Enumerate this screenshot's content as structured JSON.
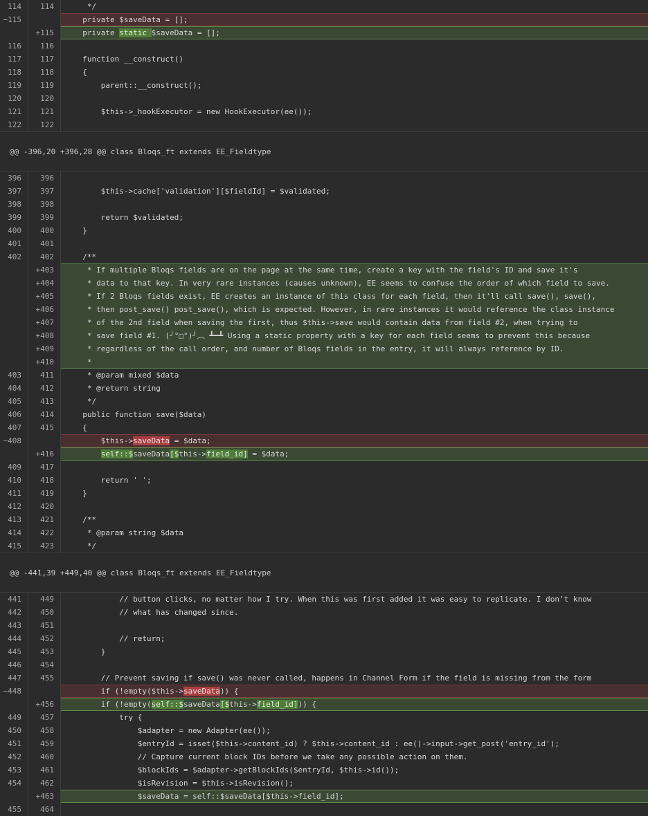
{
  "diff": {
    "blocks": [
      {
        "type": "line",
        "kind": "ctx",
        "old": "114",
        "new": "114",
        "segs": [
          {
            "t": "   */"
          }
        ]
      },
      {
        "type": "line",
        "kind": "del",
        "old": "−115",
        "new": "",
        "segs": [
          {
            "t": "  private $saveData = [];"
          }
        ]
      },
      {
        "type": "line",
        "kind": "add",
        "old": "",
        "new": "+115",
        "segs": [
          {
            "t": "  private "
          },
          {
            "t": "static ",
            "hl": true
          },
          {
            "t": "$saveData = [];"
          }
        ]
      },
      {
        "type": "line",
        "kind": "ctx",
        "old": "116",
        "new": "116",
        "segs": [
          {
            "t": ""
          }
        ]
      },
      {
        "type": "line",
        "kind": "ctx",
        "old": "117",
        "new": "117",
        "segs": [
          {
            "t": "  function __construct()"
          }
        ]
      },
      {
        "type": "line",
        "kind": "ctx",
        "old": "118",
        "new": "118",
        "segs": [
          {
            "t": "  {"
          }
        ]
      },
      {
        "type": "line",
        "kind": "ctx",
        "old": "119",
        "new": "119",
        "segs": [
          {
            "t": "      parent::__construct();"
          }
        ]
      },
      {
        "type": "line",
        "kind": "ctx",
        "old": "120",
        "new": "120",
        "segs": [
          {
            "t": ""
          }
        ]
      },
      {
        "type": "line",
        "kind": "ctx",
        "old": "121",
        "new": "121",
        "segs": [
          {
            "t": "      $this->_hookExecutor = new HookExecutor(ee());"
          }
        ]
      },
      {
        "type": "line",
        "kind": "ctx",
        "old": "122",
        "new": "122",
        "segs": [
          {
            "t": ""
          }
        ]
      },
      {
        "type": "hunk",
        "text": "@@ -396,20 +396,28 @@ class Bloqs_ft extends EE_Fieldtype"
      },
      {
        "type": "line",
        "kind": "ctx",
        "old": "396",
        "new": "396",
        "segs": [
          {
            "t": ""
          }
        ]
      },
      {
        "type": "line",
        "kind": "ctx",
        "old": "397",
        "new": "397",
        "segs": [
          {
            "t": "      $this->cache['validation'][$fieldId] = $validated;"
          }
        ]
      },
      {
        "type": "line",
        "kind": "ctx",
        "old": "398",
        "new": "398",
        "segs": [
          {
            "t": ""
          }
        ]
      },
      {
        "type": "line",
        "kind": "ctx",
        "old": "399",
        "new": "399",
        "segs": [
          {
            "t": "      return $validated;"
          }
        ]
      },
      {
        "type": "line",
        "kind": "ctx",
        "old": "400",
        "new": "400",
        "segs": [
          {
            "t": "  }"
          }
        ]
      },
      {
        "type": "line",
        "kind": "ctx",
        "old": "401",
        "new": "401",
        "segs": [
          {
            "t": ""
          }
        ]
      },
      {
        "type": "line",
        "kind": "ctx",
        "old": "402",
        "new": "402",
        "segs": [
          {
            "t": "  /**"
          }
        ]
      },
      {
        "type": "line",
        "kind": "add",
        "grp": "first",
        "old": "",
        "new": "+403",
        "segs": [
          {
            "t": "   * If multiple Bloqs fields are on the page at the same time, create a key with the field's ID and save it's"
          }
        ]
      },
      {
        "type": "line",
        "kind": "add",
        "grp": "mid",
        "old": "",
        "new": "+404",
        "segs": [
          {
            "t": "   * data to that key. In very rare instances (causes unknown), EE seems to confuse the order of which field to save."
          }
        ]
      },
      {
        "type": "line",
        "kind": "add",
        "grp": "mid",
        "old": "",
        "new": "+405",
        "segs": [
          {
            "t": "   * If 2 Bloqs fields exist, EE creates an instance of this class for each field, then it'll call save(), save(),"
          }
        ]
      },
      {
        "type": "line",
        "kind": "add",
        "grp": "mid",
        "old": "",
        "new": "+406",
        "segs": [
          {
            "t": "   * then post_save() post_save(), which is expected. However, in rare instances it would reference the class instance"
          }
        ]
      },
      {
        "type": "line",
        "kind": "add",
        "grp": "mid",
        "old": "",
        "new": "+407",
        "segs": [
          {
            "t": "   * of the 2nd field when saving the first, thus $this->save would contain data from field #2, when trying to"
          }
        ]
      },
      {
        "type": "line",
        "kind": "add",
        "grp": "mid",
        "old": "",
        "new": "+408",
        "segs": [
          {
            "t": "   * save field #1. (╯°□°)╯︵ ┻━┻ Using a static property with a key for each field seems to prevent this because"
          }
        ]
      },
      {
        "type": "line",
        "kind": "add",
        "grp": "mid",
        "old": "",
        "new": "+409",
        "segs": [
          {
            "t": "   * regardless of the call order, and number of Bloqs fields in the entry, it will always reference by ID."
          }
        ]
      },
      {
        "type": "line",
        "kind": "add",
        "grp": "last",
        "old": "",
        "new": "+410",
        "segs": [
          {
            "t": "   *"
          }
        ]
      },
      {
        "type": "line",
        "kind": "ctx",
        "old": "403",
        "new": "411",
        "segs": [
          {
            "t": "   * @param mixed $data"
          }
        ]
      },
      {
        "type": "line",
        "kind": "ctx",
        "old": "404",
        "new": "412",
        "segs": [
          {
            "t": "   * @return string"
          }
        ]
      },
      {
        "type": "line",
        "kind": "ctx",
        "old": "405",
        "new": "413",
        "segs": [
          {
            "t": "   */"
          }
        ]
      },
      {
        "type": "line",
        "kind": "ctx",
        "old": "406",
        "new": "414",
        "segs": [
          {
            "t": "  public function save($data)"
          }
        ]
      },
      {
        "type": "line",
        "kind": "ctx",
        "old": "407",
        "new": "415",
        "segs": [
          {
            "t": "  {"
          }
        ]
      },
      {
        "type": "line",
        "kind": "del",
        "old": "−408",
        "new": "",
        "segs": [
          {
            "t": "      $this->"
          },
          {
            "t": "saveData",
            "hl": true
          },
          {
            "t": " = $data;"
          }
        ]
      },
      {
        "type": "line",
        "kind": "add",
        "old": "",
        "new": "+416",
        "segs": [
          {
            "t": "      "
          },
          {
            "t": "self::$",
            "hl": true
          },
          {
            "t": "saveData"
          },
          {
            "t": "[$",
            "hl": true
          },
          {
            "t": "this->"
          },
          {
            "t": "field_id]",
            "hl": true
          },
          {
            "t": " = $data;"
          }
        ]
      },
      {
        "type": "line",
        "kind": "ctx",
        "old": "409",
        "new": "417",
        "segs": [
          {
            "t": ""
          }
        ]
      },
      {
        "type": "line",
        "kind": "ctx",
        "old": "410",
        "new": "418",
        "segs": [
          {
            "t": "      return ' ';"
          }
        ]
      },
      {
        "type": "line",
        "kind": "ctx",
        "old": "411",
        "new": "419",
        "segs": [
          {
            "t": "  }"
          }
        ]
      },
      {
        "type": "line",
        "kind": "ctx",
        "old": "412",
        "new": "420",
        "segs": [
          {
            "t": ""
          }
        ]
      },
      {
        "type": "line",
        "kind": "ctx",
        "old": "413",
        "new": "421",
        "segs": [
          {
            "t": "  /**"
          }
        ]
      },
      {
        "type": "line",
        "kind": "ctx",
        "old": "414",
        "new": "422",
        "segs": [
          {
            "t": "   * @param string $data"
          }
        ]
      },
      {
        "type": "line",
        "kind": "ctx",
        "old": "415",
        "new": "423",
        "segs": [
          {
            "t": "   */"
          }
        ]
      },
      {
        "type": "hunk",
        "text": "@@ -441,39 +449,40 @@ class Bloqs_ft extends EE_Fieldtype"
      },
      {
        "type": "line",
        "kind": "ctx",
        "old": "441",
        "new": "449",
        "segs": [
          {
            "t": "          // button clicks, no matter how I try. When this was first added it was easy to replicate. I don't know"
          }
        ]
      },
      {
        "type": "line",
        "kind": "ctx",
        "old": "442",
        "new": "450",
        "segs": [
          {
            "t": "          // what has changed since."
          }
        ]
      },
      {
        "type": "line",
        "kind": "ctx",
        "old": "443",
        "new": "451",
        "segs": [
          {
            "t": ""
          }
        ]
      },
      {
        "type": "line",
        "kind": "ctx",
        "old": "444",
        "new": "452",
        "segs": [
          {
            "t": "          // return;"
          }
        ]
      },
      {
        "type": "line",
        "kind": "ctx",
        "old": "445",
        "new": "453",
        "segs": [
          {
            "t": "      }"
          }
        ]
      },
      {
        "type": "line",
        "kind": "ctx",
        "old": "446",
        "new": "454",
        "segs": [
          {
            "t": ""
          }
        ]
      },
      {
        "type": "line",
        "kind": "ctx",
        "old": "447",
        "new": "455",
        "segs": [
          {
            "t": "      // Prevent saving if save() was never called, happens in Channel Form if the field is missing from the form"
          }
        ]
      },
      {
        "type": "line",
        "kind": "del",
        "old": "−448",
        "new": "",
        "segs": [
          {
            "t": "      if (!empty($this->"
          },
          {
            "t": "saveData",
            "hl": true
          },
          {
            "t": ")) {"
          }
        ]
      },
      {
        "type": "line",
        "kind": "add",
        "old": "",
        "new": "+456",
        "segs": [
          {
            "t": "      if (!empty("
          },
          {
            "t": "self::$",
            "hl": true
          },
          {
            "t": "saveData"
          },
          {
            "t": "[$",
            "hl": true
          },
          {
            "t": "this->"
          },
          {
            "t": "field_id]",
            "hl": true
          },
          {
            "t": ")) {"
          }
        ]
      },
      {
        "type": "line",
        "kind": "ctx",
        "old": "449",
        "new": "457",
        "segs": [
          {
            "t": "          try {"
          }
        ]
      },
      {
        "type": "line",
        "kind": "ctx",
        "old": "450",
        "new": "458",
        "segs": [
          {
            "t": "              $adapter = new Adapter(ee());"
          }
        ]
      },
      {
        "type": "line",
        "kind": "ctx",
        "old": "451",
        "new": "459",
        "segs": [
          {
            "t": "              $entryId = isset($this->content_id) ? $this->content_id : ee()->input->get_post('entry_id');"
          }
        ]
      },
      {
        "type": "line",
        "kind": "ctx",
        "old": "452",
        "new": "460",
        "segs": [
          {
            "t": "              // Capture current block IDs before we take any possible action on them."
          }
        ]
      },
      {
        "type": "line",
        "kind": "ctx",
        "old": "453",
        "new": "461",
        "segs": [
          {
            "t": "              $blockIds = $adapter->getBlockIds($entryId, $this->id());"
          }
        ]
      },
      {
        "type": "line",
        "kind": "ctx",
        "old": "454",
        "new": "462",
        "segs": [
          {
            "t": "              $isRevision = $this->isRevision();"
          }
        ]
      },
      {
        "type": "line",
        "kind": "add",
        "old": "",
        "new": "+463",
        "segs": [
          {
            "t": "              $saveData = self::$saveData[$this->field_id];"
          }
        ]
      },
      {
        "type": "line",
        "kind": "ctx",
        "old": "455",
        "new": "464",
        "segs": [
          {
            "t": ""
          }
        ]
      }
    ]
  }
}
